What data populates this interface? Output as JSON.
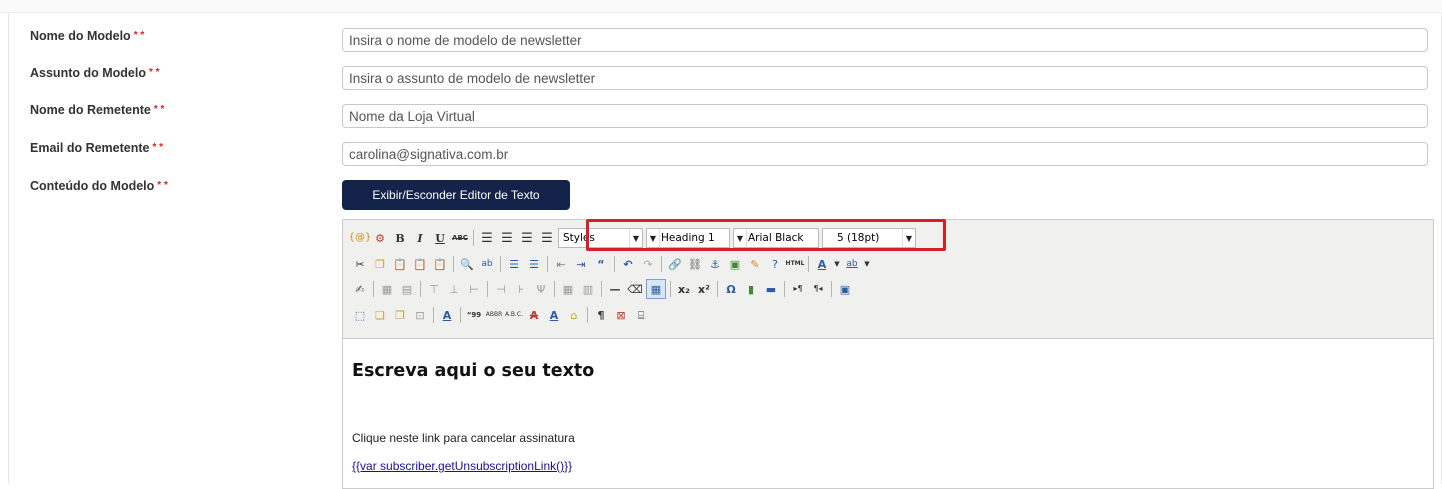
{
  "form": {
    "required_marker": "* *",
    "fields": [
      {
        "label": "Nome do Modelo",
        "value": "Insira o nome de modelo de newsletter"
      },
      {
        "label": "Assunto do Modelo",
        "value": "Insira o assunto de modelo de newsletter"
      },
      {
        "label": "Nome do Remetente",
        "value": "Nome da Loja Virtual"
      },
      {
        "label": "Email do Remetente",
        "value": "carolina@signativa.com.br"
      }
    ],
    "content_label": "Conteúdo do Modelo",
    "toggle_button_label": "Exibir/Esconder Editor de Texto"
  },
  "editor": {
    "toolbar": {
      "dropdowns": {
        "styles": "Styles",
        "format": "Heading 1",
        "font_family": "Arial Black",
        "font_size": "5 (18pt)"
      },
      "row1_buttons": [
        "variable-icon",
        "widget-icon",
        "bold-icon",
        "italic-icon",
        "underline-icon",
        "strikethrough-icon",
        "align-left-icon",
        "align-center-icon",
        "align-right-icon",
        "align-justify-icon"
      ],
      "row2_buttons": [
        "cut-icon",
        "copy-icon",
        "paste-icon",
        "paste-text-icon",
        "paste-word-icon",
        "find-icon",
        "replace-icon",
        "bullet-list-icon",
        "numbered-list-icon",
        "outdent-icon",
        "indent-icon",
        "blockquote-icon",
        "undo-icon",
        "redo-icon",
        "link-icon",
        "unlink-icon",
        "anchor-icon",
        "image-icon",
        "cleanup-icon",
        "help-icon",
        "html-icon",
        "text-color-icon",
        "background-color-icon"
      ],
      "row3_buttons": [
        "edit-icon",
        "table-icon",
        "row-props-icon",
        "cell-props-icon",
        "insert-row-before-icon",
        "insert-row-after-icon",
        "delete-row-icon",
        "insert-col-before-icon",
        "insert-col-after-icon",
        "delete-col-icon",
        "split-cells-icon",
        "merge-cells-icon",
        "horizontal-rule-icon",
        "remove-format-icon",
        "visual-aid-icon",
        "subscript-icon",
        "superscript-icon",
        "special-char-icon",
        "media-icon",
        "advanced-hr-icon",
        "ltr-icon",
        "rtl-icon",
        "fullscreen-icon"
      ],
      "row4_buttons": [
        "insert-layer-icon",
        "move-forward-icon",
        "move-backward-icon",
        "absolute-icon",
        "styles-props-icon",
        "cite-icon",
        "abbr-icon",
        "acronym-icon",
        "delete-text-icon",
        "insert-text-icon",
        "attributes-icon",
        "show-blocks-icon",
        "non-breaking-icon",
        "page-break-icon"
      ]
    },
    "content": {
      "heading": "Escreva aqui o seu texto",
      "paragraph": "Clique neste link para cancelar assinatura",
      "link": "{{var subscriber.getUnsubscriptionLink()}}"
    }
  },
  "highlight_color": "#d61f26",
  "button_color": "#13234a"
}
